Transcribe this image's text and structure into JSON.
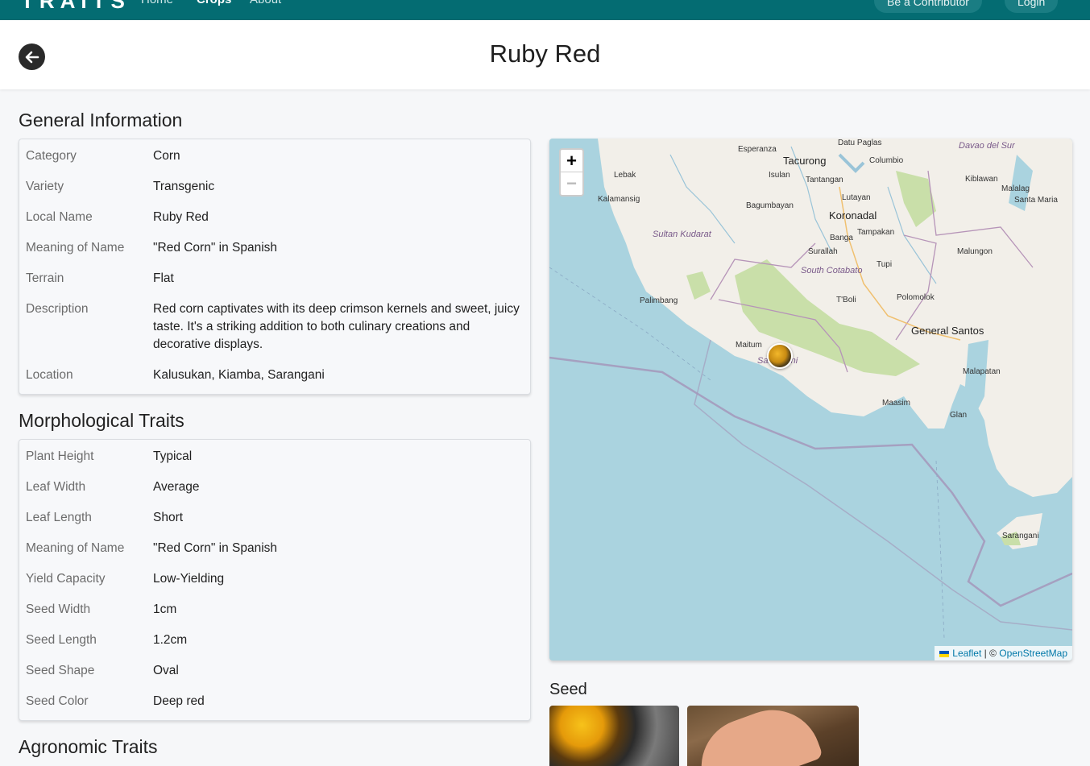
{
  "nav": {
    "brand": "TRAITS",
    "links": [
      "Home",
      "Crops",
      "About"
    ],
    "active": "Crops",
    "contributor_button": "Be a Contributor",
    "login_button": "Login"
  },
  "header": {
    "title": "Ruby Red"
  },
  "general": {
    "title": "General Information",
    "rows": [
      {
        "label": "Category",
        "value": "Corn"
      },
      {
        "label": "Variety",
        "value": "Transgenic"
      },
      {
        "label": "Local Name",
        "value": "Ruby Red"
      },
      {
        "label": "Meaning of Name",
        "value": "\"Red Corn\" in Spanish"
      },
      {
        "label": "Terrain",
        "value": "Flat"
      },
      {
        "label": "Description",
        "value": "Red corn captivates with its deep crimson kernels and sweet, juicy taste. It's a striking addition to both culinary creations and decorative displays."
      },
      {
        "label": "Location",
        "value": "Kalusukan, Kiamba, Sarangani"
      }
    ]
  },
  "morphological": {
    "title": "Morphological Traits",
    "rows": [
      {
        "label": "Plant Height",
        "value": "Typical"
      },
      {
        "label": "Leaf Width",
        "value": "Average"
      },
      {
        "label": "Leaf Length",
        "value": "Short"
      },
      {
        "label": "Meaning of Name",
        "value": "\"Red Corn\" in Spanish"
      },
      {
        "label": "Yield Capacity",
        "value": "Low-Yielding"
      },
      {
        "label": "Seed Width",
        "value": "1cm"
      },
      {
        "label": "Seed Length",
        "value": "1.2cm"
      },
      {
        "label": "Seed Shape",
        "value": "Oval"
      },
      {
        "label": "Seed Color",
        "value": "Deep red"
      }
    ]
  },
  "agronomic": {
    "title": "Agronomic Traits"
  },
  "map": {
    "zoom_in": "+",
    "zoom_out": "−",
    "attribution_leaflet": "Leaflet",
    "attribution_sep": " | © ",
    "attribution_osm": "OpenStreetMap",
    "labels": {
      "esperanza": "Esperanza",
      "tacurong": "Tacurong",
      "datu_paglas": "Datu Paglas",
      "davao_del_sur": "Davao del Sur",
      "lebak": "Lebak",
      "isulan": "Isulan",
      "columbio": "Columbio",
      "tantangan": "Tantangan",
      "kiblawan": "Kiblawan",
      "malalag": "Malalag",
      "kalamansig": "Kalamansig",
      "santa_maria": "Santa Maria",
      "bagumbayan": "Bagumbayan",
      "lutayan": "Lutayan",
      "koronadal": "Koronadal",
      "sultan_kudarat": "Sultan Kudarat",
      "tampakan": "Tampakan",
      "banga": "Banga",
      "surallah": "Surallah",
      "malungon": "Malungon",
      "tupi": "Tupi",
      "south_cotabato": "South Cotabato",
      "palimbang": "Palimbang",
      "tboli": "T'Boli",
      "polomolok": "Polomolok",
      "general_santos": "General Santos",
      "maitum": "Maitum",
      "sarangani_town": "Sarangani",
      "malapatan": "Malapatan",
      "maasim": "Maasim",
      "glan": "Glan",
      "sarangani_island": "Sarangani"
    }
  },
  "seed": {
    "title": "Seed"
  }
}
